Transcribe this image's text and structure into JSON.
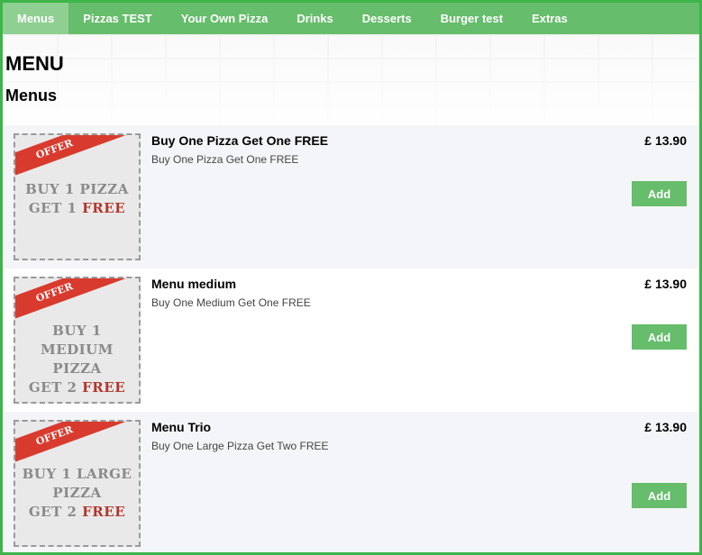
{
  "nav": {
    "items": [
      "Menus",
      "Pizzas TEST",
      "Your Own Pizza",
      "Drinks",
      "Desserts",
      "Burger test",
      "Extras"
    ],
    "active_index": 0
  },
  "header": {
    "title": "MENU",
    "subtitle": "Menus"
  },
  "items": [
    {
      "name": "Buy One Pizza Get One FREE",
      "description": "Buy One Pizza Get One FREE",
      "price": "£ 13.90",
      "add_label": "Add",
      "image": {
        "badge": "OFFER",
        "lines": [
          {
            "gray": "BUY 1 PIZZA",
            "red": ""
          },
          {
            "gray": "GET 1 ",
            "red": "FREE"
          }
        ]
      }
    },
    {
      "name": "Menu medium",
      "description": "Buy One Medium Get One FREE",
      "price": "£ 13.90",
      "add_label": "Add",
      "image": {
        "badge": "OFFER",
        "lines": [
          {
            "gray": "BUY 1 MEDIUM",
            "red": ""
          },
          {
            "gray": "PIZZA",
            "red": ""
          },
          {
            "gray": "GET 2 ",
            "red": "FREE"
          }
        ]
      }
    },
    {
      "name": "Menu Trio",
      "description": "Buy One Large Pizza Get Two FREE",
      "price": "£ 13.90",
      "add_label": "Add",
      "image": {
        "badge": "OFFER",
        "lines": [
          {
            "gray": "BUY 1 LARGE",
            "red": ""
          },
          {
            "gray": "PIZZA",
            "red": ""
          },
          {
            "gray": "GET 2 ",
            "red": "FREE"
          }
        ]
      }
    }
  ],
  "colors": {
    "nav_bg": "#66bd6b",
    "nav_active_bg": "#8fcf92",
    "border": "#3db54a",
    "add_button": "#66bd6b",
    "offer_ribbon": "#d83b2e"
  }
}
